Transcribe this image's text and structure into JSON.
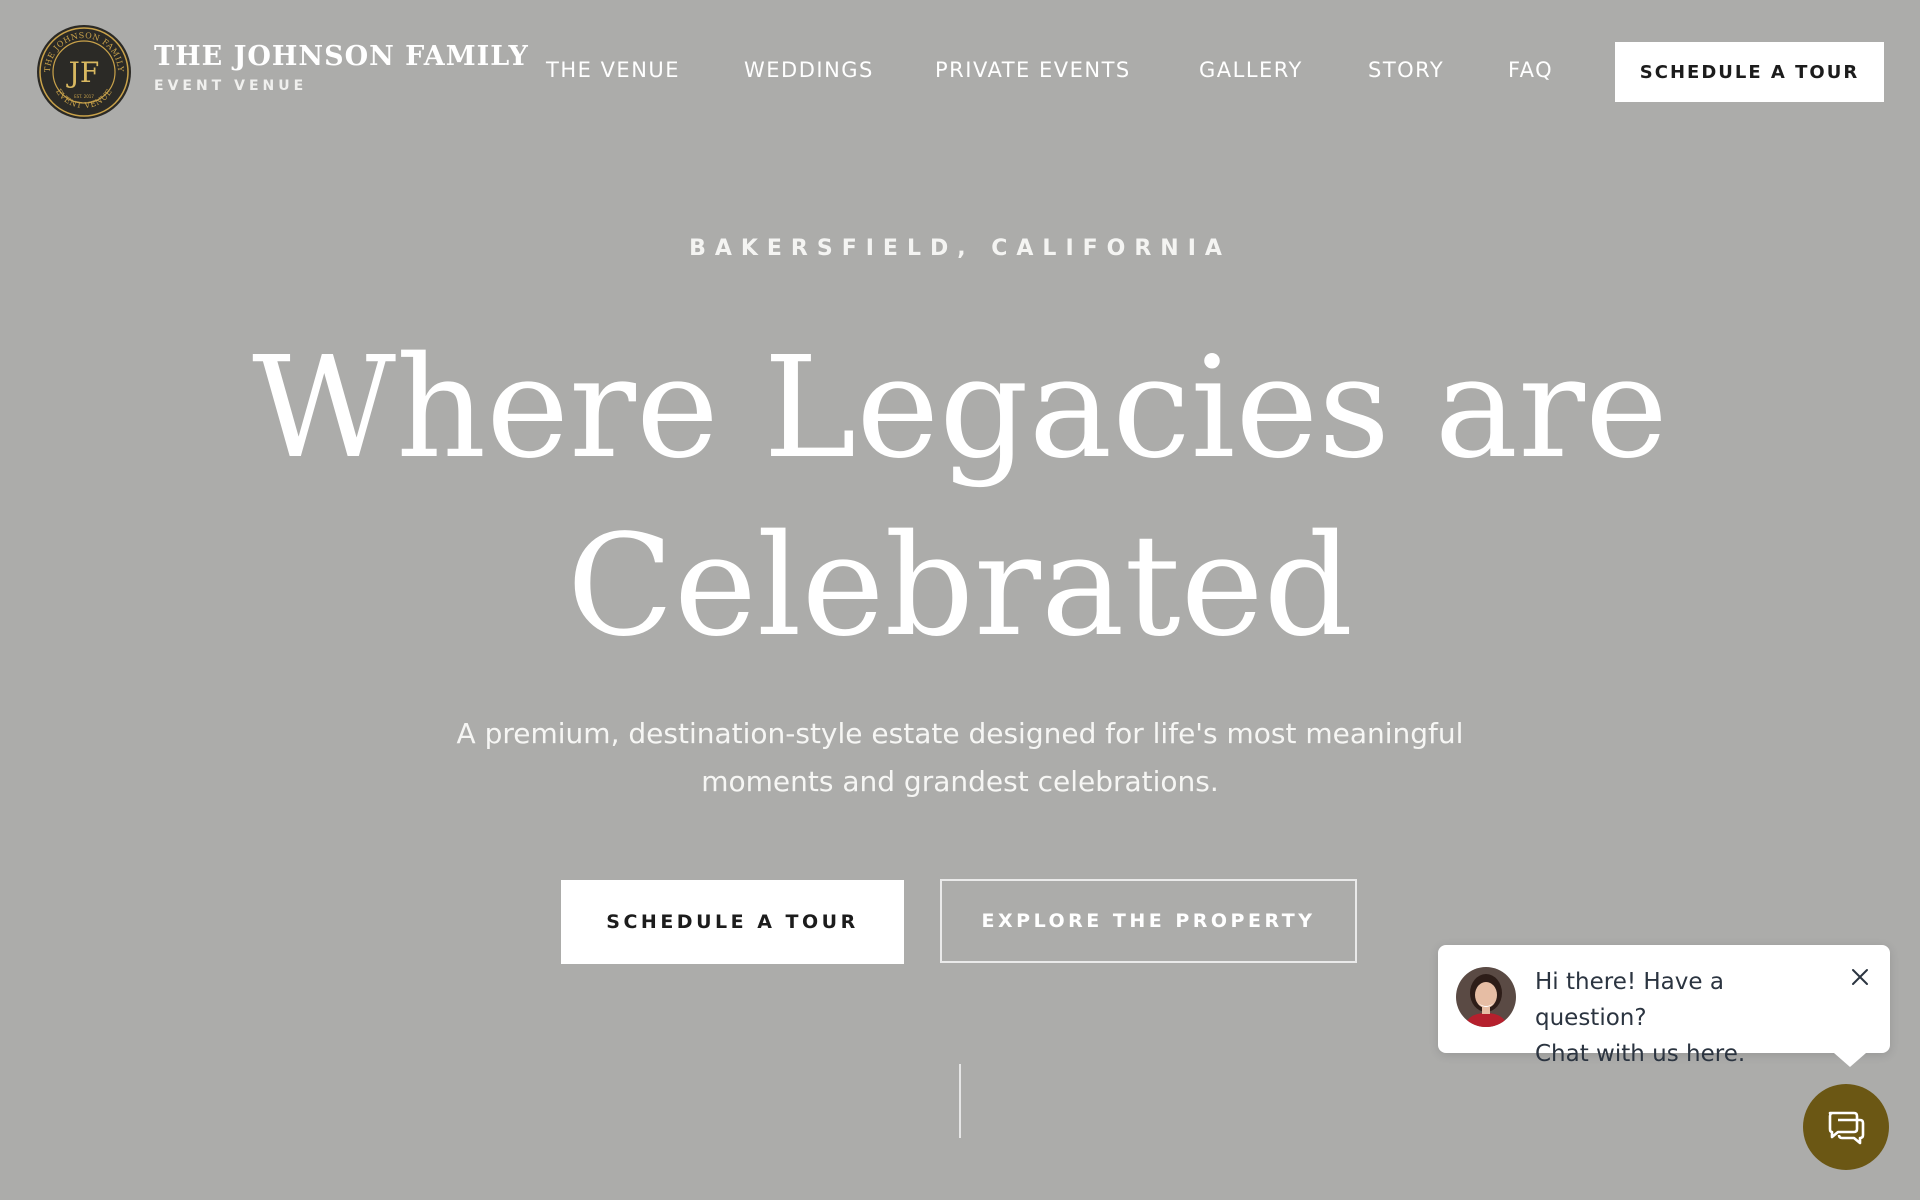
{
  "colors": {
    "page_background": "#acacaa",
    "text": "#ffffff",
    "button_bg": "#ffffff",
    "button_text": "#1c1c1c",
    "chat_launcher": "#6b5714",
    "logo_gold": "#c9a24a"
  },
  "header": {
    "logo": {
      "monogram": "JF",
      "ring_text_top": "THE JOHNSON FAMILY",
      "ring_text_bottom": "EVENT VENUE",
      "established": "EST. 2017"
    },
    "brand_name": "THE JOHNSON FAMILY",
    "brand_sub": "EVENT VENUE",
    "nav": [
      {
        "label": "THE VENUE"
      },
      {
        "label": "WEDDINGS"
      },
      {
        "label": "PRIVATE EVENTS"
      },
      {
        "label": "GALLERY"
      },
      {
        "label": "STORY"
      },
      {
        "label": "FAQ"
      }
    ],
    "cta_label": "SCHEDULE A TOUR"
  },
  "hero": {
    "eyebrow": "BAKERSFIELD, CALIFORNIA",
    "title_line1": "Where Legacies are",
    "title_line2": "Celebrated",
    "subtitle": "A premium, destination-style estate designed for life's most meaningful moments and grandest celebrations.",
    "primary_button": "SCHEDULE A TOUR",
    "secondary_button": "EXPLORE THE PROPERTY"
  },
  "chat": {
    "message_line1": "Hi there! Have a question?",
    "message_line2": "Chat with us here.",
    "close_icon": "close-icon",
    "launcher_icon": "chat-bubbles-icon"
  }
}
